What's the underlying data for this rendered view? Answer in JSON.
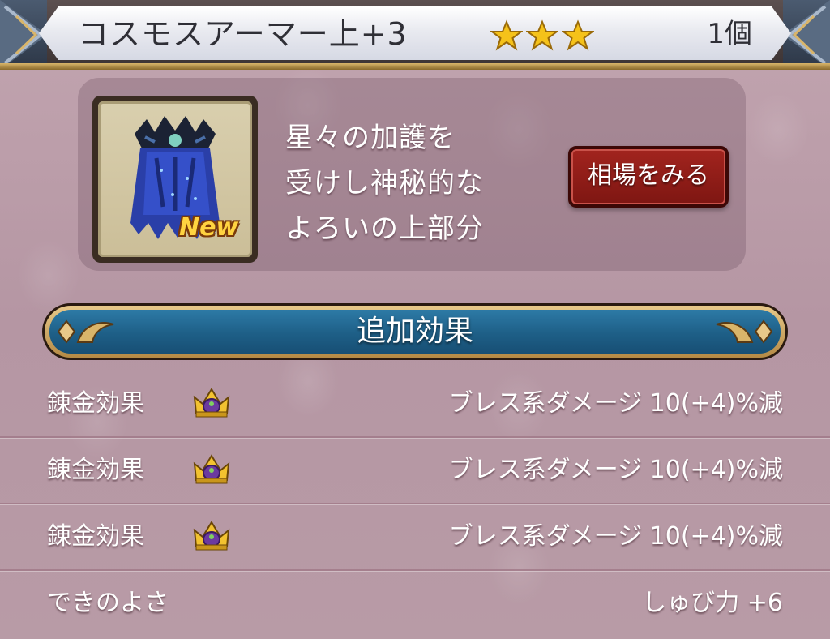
{
  "header": {
    "item_name": "コスモスアーマー上+3",
    "stars": 3,
    "count": "1個"
  },
  "item": {
    "icon": "cosmos-armor-top-icon",
    "badge": "New",
    "description_lines": [
      "星々の加護を",
      "受けし神秘的な",
      "よろいの上部分"
    ],
    "market_button": "相場をみる"
  },
  "section": {
    "title": "追加効果"
  },
  "effects": [
    {
      "label": "錬金効果",
      "icon": "crown-icon",
      "value": "ブレス系ダメージ 10(+4)%減"
    },
    {
      "label": "錬金効果",
      "icon": "crown-icon",
      "value": "ブレス系ダメージ 10(+4)%減"
    },
    {
      "label": "錬金効果",
      "icon": "crown-icon",
      "value": "ブレス系ダメージ 10(+4)%減"
    }
  ],
  "quality": {
    "label": "できのよさ",
    "value": "しゅび力 +6"
  },
  "colors": {
    "star": "#f5c21a",
    "banner": "#1e5f87",
    "button": "#8e1c17",
    "badge": "#ffd340"
  }
}
